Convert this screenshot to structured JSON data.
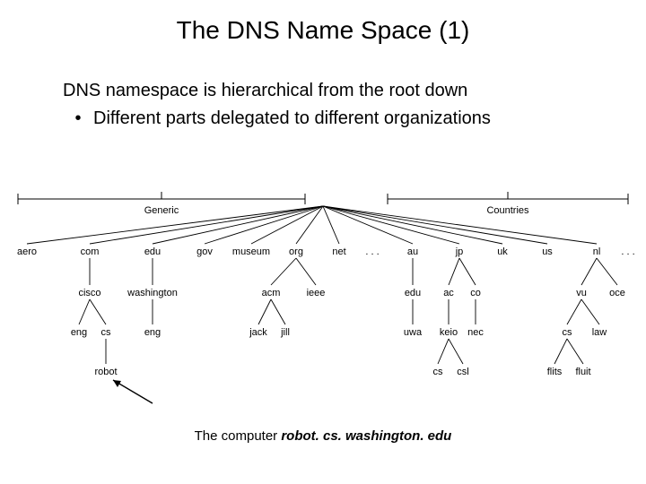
{
  "title": "The DNS Name Space (1)",
  "desc_line1": "DNS namespace is hierarchical from the root down",
  "bullet": "•",
  "desc_line2": "Different parts delegated to different organizations",
  "brackets": {
    "generic": "Generic",
    "countries": "Countries"
  },
  "ellipsis": ". . .",
  "level1": {
    "aero": "aero",
    "com": "com",
    "edu": "edu",
    "gov": "gov",
    "museum": "museum",
    "org": "org",
    "net": "net",
    "au": "au",
    "jp": "jp",
    "uk": "uk",
    "us": "us",
    "nl": "nl"
  },
  "level2": {
    "cisco": "cisco",
    "washington": "washington",
    "acm": "acm",
    "ieee": "ieee",
    "edu_au": "edu",
    "ac": "ac",
    "co": "co",
    "vu": "vu",
    "oce": "oce"
  },
  "level3": {
    "eng1": "eng",
    "cs1": "cs",
    "eng2": "eng",
    "jack": "jack",
    "jill": "jill",
    "uwa": "uwa",
    "keio": "keio",
    "nec": "nec",
    "cs_nl": "cs",
    "law": "law"
  },
  "level4": {
    "robot": "robot",
    "cs_keio": "cs",
    "csl": "csl",
    "flits": "flits",
    "fluit": "fluit"
  },
  "caption_prefix": "The computer ",
  "caption_addr": "robot. cs. washington. edu"
}
